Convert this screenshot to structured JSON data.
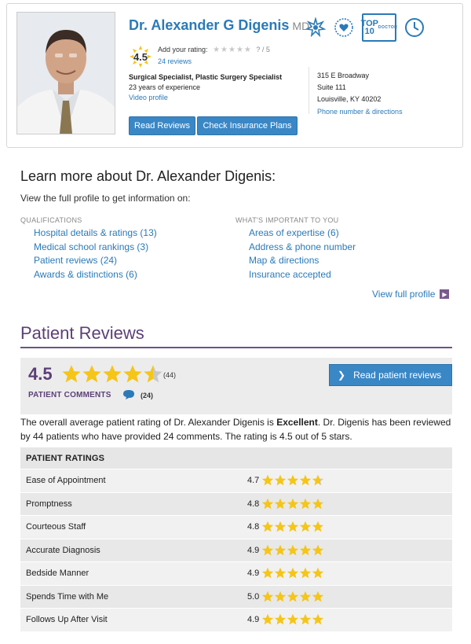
{
  "doctor": {
    "name": "Dr. Alexander G Digenis",
    "credential": "MD",
    "score": "4.5",
    "add_rating_label": "Add your rating:",
    "rating_scale": "? / 5",
    "reviews_link": "24 reviews",
    "specialty": "Surgical Specialist, Plastic Surgery Specialist",
    "experience": "23 years of experience",
    "video_link": "Video profile",
    "address": [
      "315 E Broadway",
      "Suite 111",
      "Louisville, KY 40202"
    ],
    "phone_link": "Phone number & directions",
    "buttons": {
      "read_reviews": "Read Reviews",
      "check_insurance": "Check Insurance Plans"
    },
    "badges": {
      "top10_line1": "TOP 10",
      "top10_line2": "DOCTOR"
    }
  },
  "learn_more": {
    "title": "Learn more about Dr. Alexander Digenis:",
    "subtitle": "View the full profile to get information on:",
    "qualifications_heading": "QUALIFICATIONS",
    "qualifications": [
      "Hospital details & ratings (13)",
      "Medical school rankings (3)",
      "Patient reviews (24)",
      "Awards & distinctions (6)"
    ],
    "important_heading": "WHAT'S IMPORTANT TO YOU",
    "important": [
      "Areas of expertise (6)",
      "Address & phone number",
      "Map & directions",
      "Insurance accepted"
    ],
    "view_full_profile": "View full profile"
  },
  "patient_reviews": {
    "title": "Patient Reviews",
    "score": "4.5",
    "score_value": 4.5,
    "rating_count": "(44)",
    "comments_label": "PATIENT COMMENTS",
    "comments_count": "(24)",
    "read_button": "Read patient reviews",
    "summary_prefix": "The overall average patient rating of Dr. Alexander Digenis is ",
    "summary_bold": "Excellent",
    "summary_suffix": ". Dr. Digenis has been reviewed by 44 patients who have provided 24 comments. The rating is 4.5 out of 5 stars.",
    "ratings_heading": "PATIENT RATINGS",
    "ratings": [
      {
        "label": "Ease of Appointment",
        "value": "4.7",
        "score": 4.7
      },
      {
        "label": "Promptness",
        "value": "4.8",
        "score": 4.8
      },
      {
        "label": "Courteous Staff",
        "value": "4.8",
        "score": 4.8
      },
      {
        "label": "Accurate Diagnosis",
        "value": "4.9",
        "score": 4.9
      },
      {
        "label": "Bedside Manner",
        "value": "4.9",
        "score": 4.9
      },
      {
        "label": "Spends Time with Me",
        "value": "5.0",
        "score": 5.0
      },
      {
        "label": "Follows Up After Visit",
        "value": "4.9",
        "score": 4.9
      }
    ]
  },
  "colors": {
    "link": "#2a7ab8",
    "brand_purple": "#5b3f78",
    "star": "#f5c518",
    "star_empty": "#c8c8c8",
    "button": "#3a87c6"
  }
}
